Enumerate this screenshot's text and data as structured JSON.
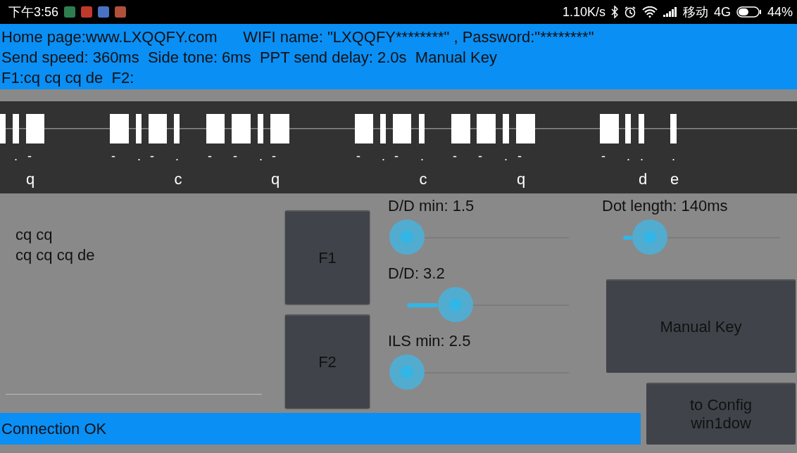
{
  "status_bar": {
    "time": "下午3:56",
    "speed": "1.10K/s",
    "carrier": "移动",
    "network": "4G",
    "battery": "44%"
  },
  "header": {
    "lines": [
      "Home page:www.LXQQFY.com      WIFI name: \"LXQQFY********\" , Password:\"********\"",
      "Send speed: 360ms  Side tone: 6ms  PPT send delay: 2.0s  Manual Key",
      "F1:cq cq cq de  F2:"
    ]
  },
  "morse": {
    "marks": [
      ".",
      "-",
      "-",
      ".",
      "-",
      ".",
      "-",
      "-",
      ".",
      "-",
      "-",
      ".",
      "-",
      ".",
      "-",
      "-",
      ".",
      "-",
      "-",
      ".",
      ".",
      "."
    ],
    "letters": [
      "q",
      "c",
      "q",
      "c",
      "q",
      "d",
      "e"
    ]
  },
  "text_area": {
    "value": "cq cq\ncq cq cq de"
  },
  "buttons": [
    "F1",
    "F2"
  ],
  "sliders": [
    {
      "label": "D/D min: 1.5",
      "level": 0
    },
    {
      "label": "D/D: 3.2",
      "level": 0.3
    },
    {
      "label": "ILS min: 2.5",
      "level": 0
    },
    {
      "label": "Dot length: 140ms",
      "level": 0.17
    }
  ],
  "manual_key_button": "Manual Key",
  "config_button": "to Config\nwin1dow",
  "connection_status": "Connection OK"
}
